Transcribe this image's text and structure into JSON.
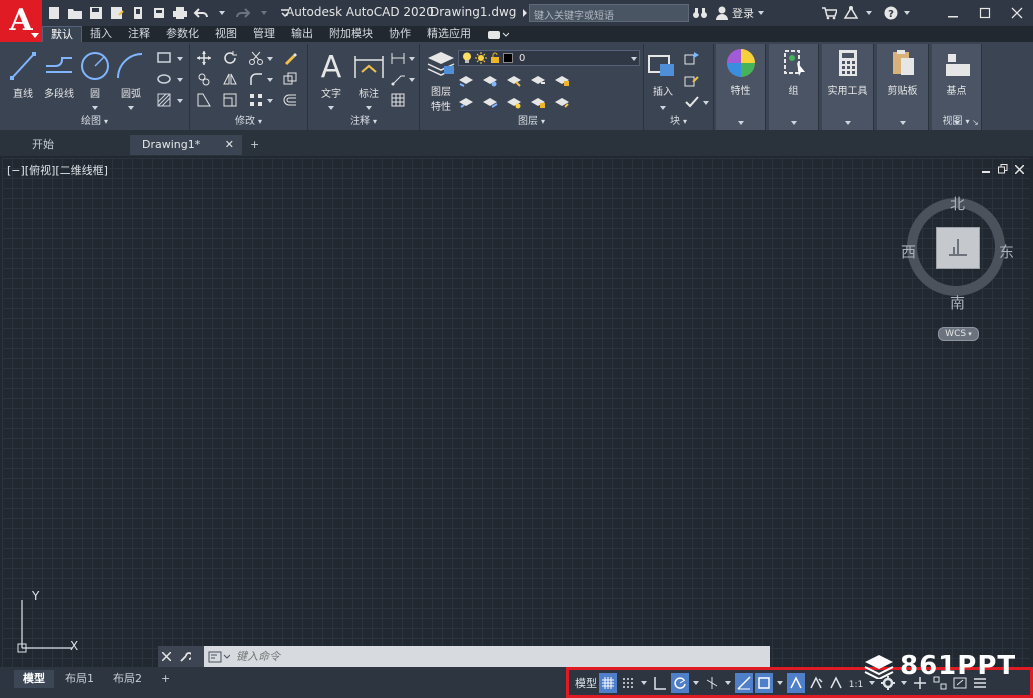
{
  "app": {
    "title": "Autodesk AutoCAD 2020",
    "document": "Drawing1.dwg",
    "app_button_letter": "A",
    "search_placeholder": "键入关键字或短语",
    "login": "登录",
    "accent": "#e01b24"
  },
  "ribbon_tabs": [
    "默认",
    "插入",
    "注释",
    "参数化",
    "视图",
    "管理",
    "输出",
    "附加模块",
    "协作",
    "精选应用"
  ],
  "ribbon": {
    "draw": {
      "title": "绘图",
      "line": "直线",
      "polyline": "多段线",
      "circle": "圆",
      "arc": "圆弧"
    },
    "modify": {
      "title": "修改"
    },
    "annotation": {
      "title": "注释",
      "text": "文字",
      "dimension": "标注"
    },
    "layers": {
      "title": "图层",
      "layer_props_1": "图层",
      "layer_props_2": "特性",
      "current_layer": "0"
    },
    "block": {
      "title": "块",
      "insert": "插入"
    },
    "properties": {
      "label": "特性"
    },
    "groups": {
      "label": "组"
    },
    "utilities": {
      "label": "实用工具"
    },
    "clipboard": {
      "label": "剪贴板"
    },
    "view": {
      "label": "基点",
      "title": "视图"
    }
  },
  "doc_tabs": {
    "start": "开始",
    "drawing": "Drawing1*",
    "add": "+"
  },
  "viewport": {
    "label": "[−][俯视][二维线框]",
    "north": "北",
    "south": "南",
    "east": "东",
    "west": "西",
    "wcs": "WCS",
    "ucs_x": "X",
    "ucs_y": "Y"
  },
  "command": {
    "placeholder": "键入命令"
  },
  "layout_tabs": {
    "model": "模型",
    "layout1": "布局1",
    "layout2": "布局2",
    "add": "+"
  },
  "status": {
    "model": "模型"
  },
  "watermark": "861PPT"
}
